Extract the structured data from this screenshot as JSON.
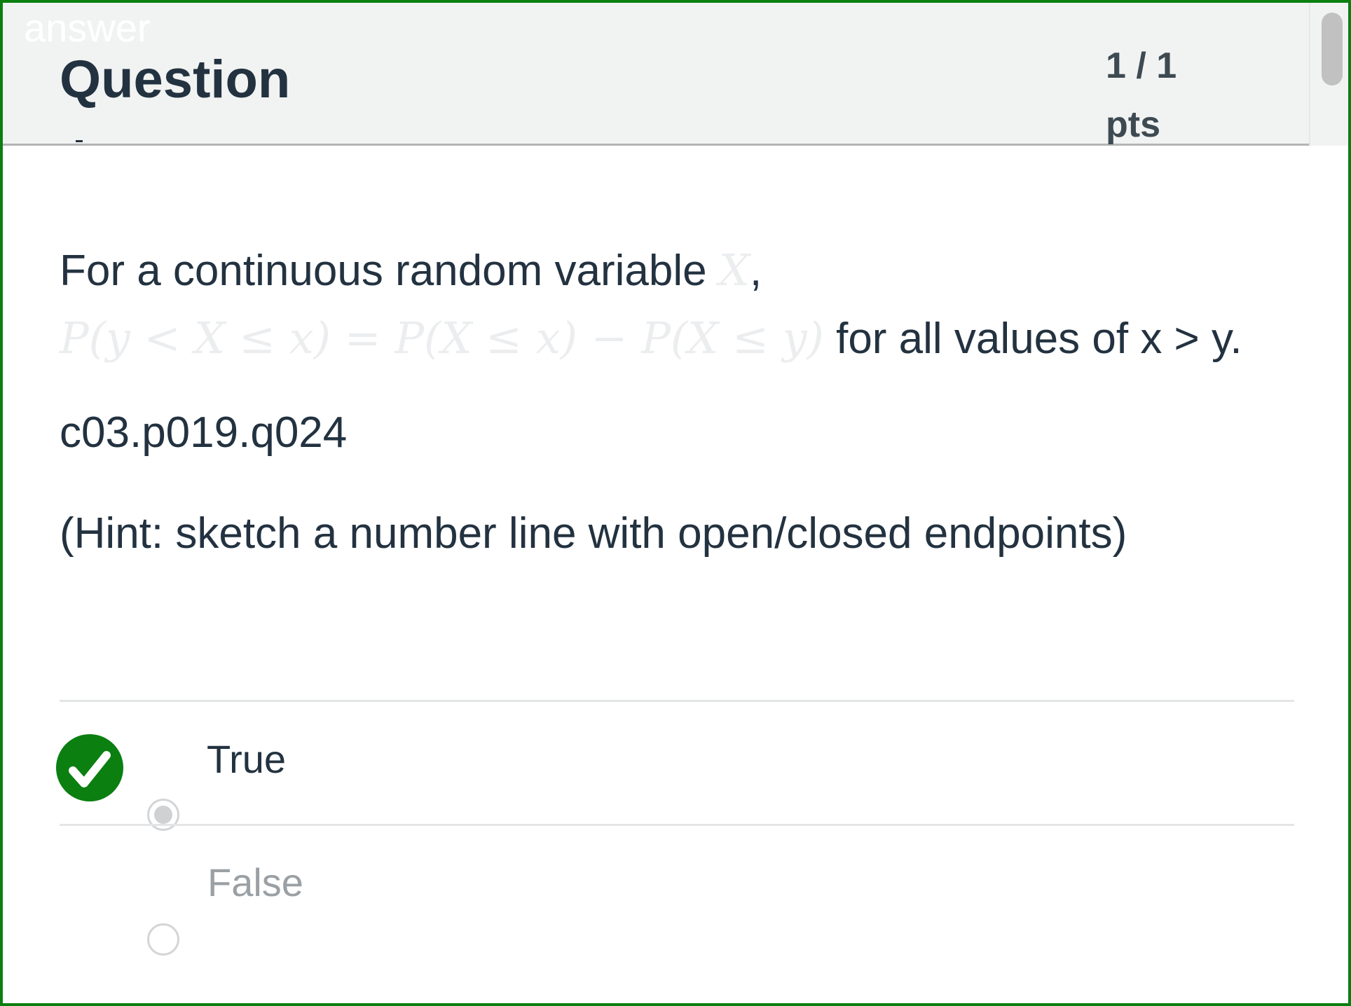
{
  "header": {
    "overlay_label": "answer",
    "title": "Question",
    "points_value": "1 / 1",
    "points_unit": "pts"
  },
  "question": {
    "text_before_math": "For a continuous random variable ",
    "math_variable": "X",
    "text_after_variable": ",",
    "math_equation": "P(y < X ≤ x) = P(X ≤ x) − P(X ≤ y)",
    "text_after_equation": " for all values of x > y.",
    "code": "c03.p019.q024",
    "hint": "(Hint: sketch a number line with open/closed endpoints)"
  },
  "answers": [
    {
      "label": "True",
      "selected": true,
      "correct": true
    },
    {
      "label": "False",
      "selected": false,
      "correct": false
    }
  ],
  "colors": {
    "correct_green": "#0b7f10",
    "header_bg": "#f1f3f2",
    "text_dark": "#233240",
    "text_muted": "#9aa0a4"
  },
  "icons": {
    "correct": "checkmark-circle-icon",
    "radio_selected": "radio-selected-icon",
    "radio_unselected": "radio-unselected-icon"
  }
}
